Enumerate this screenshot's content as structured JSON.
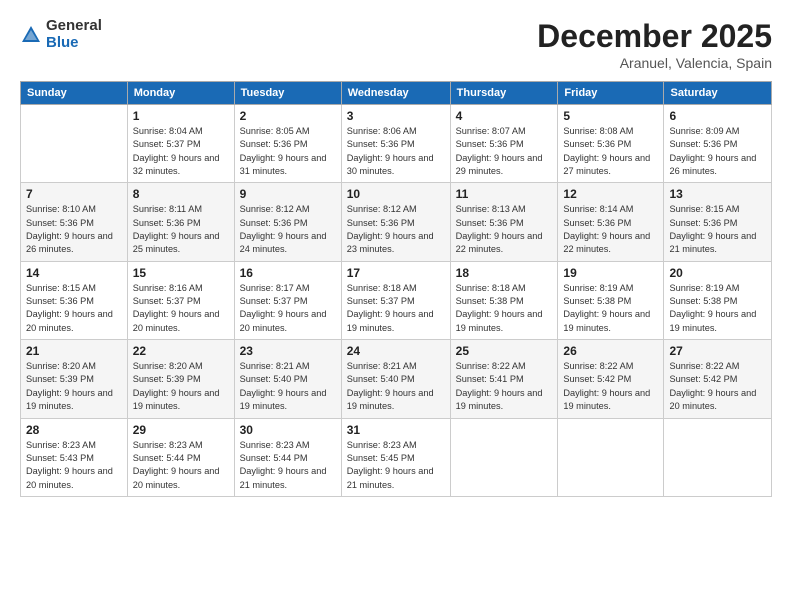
{
  "logo": {
    "general": "General",
    "blue": "Blue"
  },
  "title": "December 2025",
  "subtitle": "Aranuel, Valencia, Spain",
  "days_of_week": [
    "Sunday",
    "Monday",
    "Tuesday",
    "Wednesday",
    "Thursday",
    "Friday",
    "Saturday"
  ],
  "weeks": [
    [
      {
        "day": "",
        "sunrise": "",
        "sunset": "",
        "daylight": ""
      },
      {
        "day": "1",
        "sunrise": "Sunrise: 8:04 AM",
        "sunset": "Sunset: 5:37 PM",
        "daylight": "Daylight: 9 hours and 32 minutes."
      },
      {
        "day": "2",
        "sunrise": "Sunrise: 8:05 AM",
        "sunset": "Sunset: 5:36 PM",
        "daylight": "Daylight: 9 hours and 31 minutes."
      },
      {
        "day": "3",
        "sunrise": "Sunrise: 8:06 AM",
        "sunset": "Sunset: 5:36 PM",
        "daylight": "Daylight: 9 hours and 30 minutes."
      },
      {
        "day": "4",
        "sunrise": "Sunrise: 8:07 AM",
        "sunset": "Sunset: 5:36 PM",
        "daylight": "Daylight: 9 hours and 29 minutes."
      },
      {
        "day": "5",
        "sunrise": "Sunrise: 8:08 AM",
        "sunset": "Sunset: 5:36 PM",
        "daylight": "Daylight: 9 hours and 27 minutes."
      },
      {
        "day": "6",
        "sunrise": "Sunrise: 8:09 AM",
        "sunset": "Sunset: 5:36 PM",
        "daylight": "Daylight: 9 hours and 26 minutes."
      }
    ],
    [
      {
        "day": "7",
        "sunrise": "Sunrise: 8:10 AM",
        "sunset": "Sunset: 5:36 PM",
        "daylight": "Daylight: 9 hours and 26 minutes."
      },
      {
        "day": "8",
        "sunrise": "Sunrise: 8:11 AM",
        "sunset": "Sunset: 5:36 PM",
        "daylight": "Daylight: 9 hours and 25 minutes."
      },
      {
        "day": "9",
        "sunrise": "Sunrise: 8:12 AM",
        "sunset": "Sunset: 5:36 PM",
        "daylight": "Daylight: 9 hours and 24 minutes."
      },
      {
        "day": "10",
        "sunrise": "Sunrise: 8:12 AM",
        "sunset": "Sunset: 5:36 PM",
        "daylight": "Daylight: 9 hours and 23 minutes."
      },
      {
        "day": "11",
        "sunrise": "Sunrise: 8:13 AM",
        "sunset": "Sunset: 5:36 PM",
        "daylight": "Daylight: 9 hours and 22 minutes."
      },
      {
        "day": "12",
        "sunrise": "Sunrise: 8:14 AM",
        "sunset": "Sunset: 5:36 PM",
        "daylight": "Daylight: 9 hours and 22 minutes."
      },
      {
        "day": "13",
        "sunrise": "Sunrise: 8:15 AM",
        "sunset": "Sunset: 5:36 PM",
        "daylight": "Daylight: 9 hours and 21 minutes."
      }
    ],
    [
      {
        "day": "14",
        "sunrise": "Sunrise: 8:15 AM",
        "sunset": "Sunset: 5:36 PM",
        "daylight": "Daylight: 9 hours and 20 minutes."
      },
      {
        "day": "15",
        "sunrise": "Sunrise: 8:16 AM",
        "sunset": "Sunset: 5:37 PM",
        "daylight": "Daylight: 9 hours and 20 minutes."
      },
      {
        "day": "16",
        "sunrise": "Sunrise: 8:17 AM",
        "sunset": "Sunset: 5:37 PM",
        "daylight": "Daylight: 9 hours and 20 minutes."
      },
      {
        "day": "17",
        "sunrise": "Sunrise: 8:18 AM",
        "sunset": "Sunset: 5:37 PM",
        "daylight": "Daylight: 9 hours and 19 minutes."
      },
      {
        "day": "18",
        "sunrise": "Sunrise: 8:18 AM",
        "sunset": "Sunset: 5:38 PM",
        "daylight": "Daylight: 9 hours and 19 minutes."
      },
      {
        "day": "19",
        "sunrise": "Sunrise: 8:19 AM",
        "sunset": "Sunset: 5:38 PM",
        "daylight": "Daylight: 9 hours and 19 minutes."
      },
      {
        "day": "20",
        "sunrise": "Sunrise: 8:19 AM",
        "sunset": "Sunset: 5:38 PM",
        "daylight": "Daylight: 9 hours and 19 minutes."
      }
    ],
    [
      {
        "day": "21",
        "sunrise": "Sunrise: 8:20 AM",
        "sunset": "Sunset: 5:39 PM",
        "daylight": "Daylight: 9 hours and 19 minutes."
      },
      {
        "day": "22",
        "sunrise": "Sunrise: 8:20 AM",
        "sunset": "Sunset: 5:39 PM",
        "daylight": "Daylight: 9 hours and 19 minutes."
      },
      {
        "day": "23",
        "sunrise": "Sunrise: 8:21 AM",
        "sunset": "Sunset: 5:40 PM",
        "daylight": "Daylight: 9 hours and 19 minutes."
      },
      {
        "day": "24",
        "sunrise": "Sunrise: 8:21 AM",
        "sunset": "Sunset: 5:40 PM",
        "daylight": "Daylight: 9 hours and 19 minutes."
      },
      {
        "day": "25",
        "sunrise": "Sunrise: 8:22 AM",
        "sunset": "Sunset: 5:41 PM",
        "daylight": "Daylight: 9 hours and 19 minutes."
      },
      {
        "day": "26",
        "sunrise": "Sunrise: 8:22 AM",
        "sunset": "Sunset: 5:42 PM",
        "daylight": "Daylight: 9 hours and 19 minutes."
      },
      {
        "day": "27",
        "sunrise": "Sunrise: 8:22 AM",
        "sunset": "Sunset: 5:42 PM",
        "daylight": "Daylight: 9 hours and 20 minutes."
      }
    ],
    [
      {
        "day": "28",
        "sunrise": "Sunrise: 8:23 AM",
        "sunset": "Sunset: 5:43 PM",
        "daylight": "Daylight: 9 hours and 20 minutes."
      },
      {
        "day": "29",
        "sunrise": "Sunrise: 8:23 AM",
        "sunset": "Sunset: 5:44 PM",
        "daylight": "Daylight: 9 hours and 20 minutes."
      },
      {
        "day": "30",
        "sunrise": "Sunrise: 8:23 AM",
        "sunset": "Sunset: 5:44 PM",
        "daylight": "Daylight: 9 hours and 21 minutes."
      },
      {
        "day": "31",
        "sunrise": "Sunrise: 8:23 AM",
        "sunset": "Sunset: 5:45 PM",
        "daylight": "Daylight: 9 hours and 21 minutes."
      },
      {
        "day": "",
        "sunrise": "",
        "sunset": "",
        "daylight": ""
      },
      {
        "day": "",
        "sunrise": "",
        "sunset": "",
        "daylight": ""
      },
      {
        "day": "",
        "sunrise": "",
        "sunset": "",
        "daylight": ""
      }
    ]
  ]
}
